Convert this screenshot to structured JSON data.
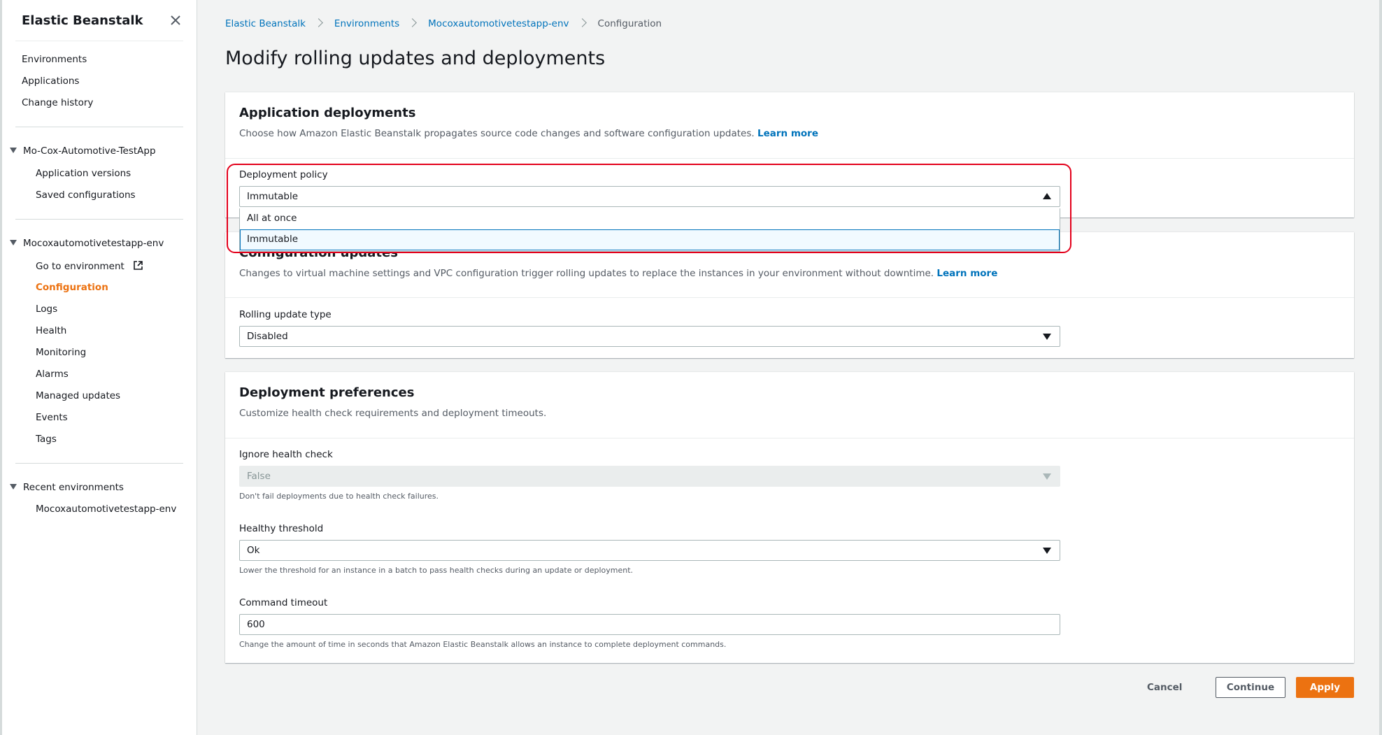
{
  "sidebar": {
    "title": "Elastic Beanstalk",
    "top_links": [
      "Environments",
      "Applications",
      "Change history"
    ],
    "app_group": {
      "label": "Mo-Cox-Automotive-TestApp",
      "items": [
        "Application versions",
        "Saved configurations"
      ]
    },
    "env_group": {
      "label": "Mocoxautomotivetestapp-env",
      "items": [
        "Go to environment",
        "Configuration",
        "Logs",
        "Health",
        "Monitoring",
        "Alarms",
        "Managed updates",
        "Events",
        "Tags"
      ],
      "active_item": "Configuration"
    },
    "recent_group": {
      "label": "Recent environments",
      "items": [
        "Mocoxautomotivetestapp-env"
      ]
    }
  },
  "breadcrumb": {
    "items": [
      "Elastic Beanstalk",
      "Environments",
      "Mocoxautomotivetestapp-env"
    ],
    "current": "Configuration"
  },
  "page_title": "Modify rolling updates and deployments",
  "app_deployments": {
    "title": "Application deployments",
    "description": "Choose how Amazon Elastic Beanstalk propagates source code changes and software configuration updates.",
    "learn_more": "Learn more",
    "policy_label": "Deployment policy",
    "policy_value": "Immutable",
    "policy_options": [
      "All at once",
      "Immutable"
    ]
  },
  "config_updates": {
    "title": "Configuration updates",
    "description": "Changes to virtual machine settings and VPC configuration trigger rolling updates to replace the instances in your environment without downtime.",
    "learn_more": "Learn more",
    "rolling_label": "Rolling update type",
    "rolling_value": "Disabled"
  },
  "deploy_prefs": {
    "title": "Deployment preferences",
    "description": "Customize health check requirements and deployment timeouts.",
    "ignore_label": "Ignore health check",
    "ignore_value": "False",
    "ignore_hint": "Don't fail deployments due to health check failures.",
    "threshold_label": "Healthy threshold",
    "threshold_value": "Ok",
    "threshold_hint": "Lower the threshold for an instance in a batch to pass health checks during an update or deployment.",
    "timeout_label": "Command timeout",
    "timeout_value": "600",
    "timeout_hint": "Change the amount of time in seconds that Amazon Elastic Beanstalk allows an instance to complete deployment commands."
  },
  "footer": {
    "cancel": "Cancel",
    "continue": "Continue",
    "apply": "Apply"
  },
  "colors": {
    "accent": "#ec7211",
    "link": "#0073bb",
    "highlight": "#e3001b"
  }
}
